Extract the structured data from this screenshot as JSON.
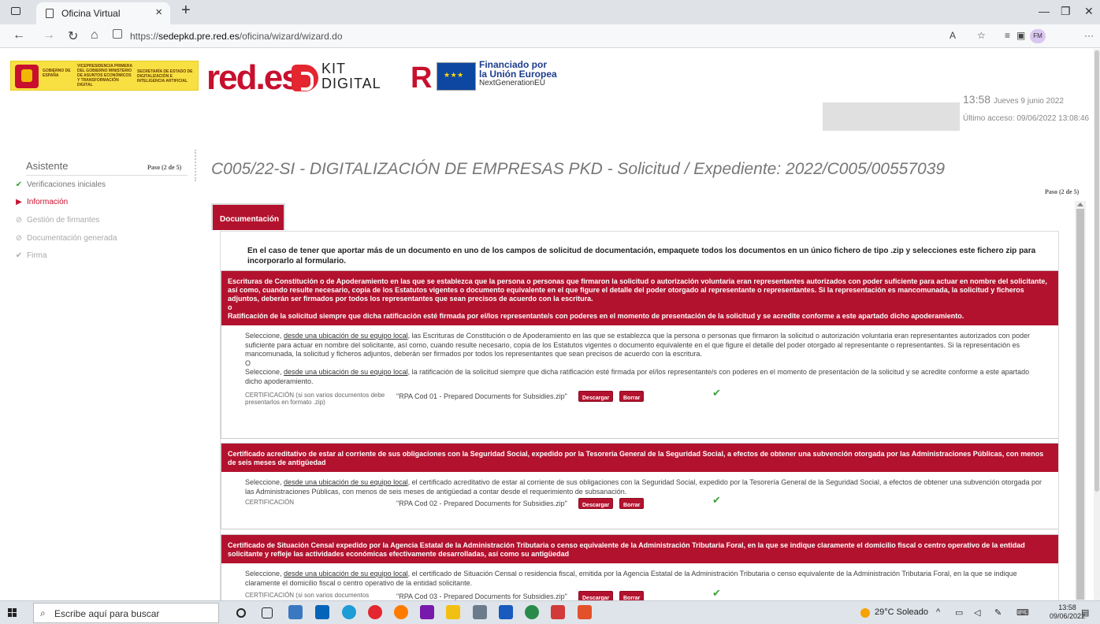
{
  "browser": {
    "tab_title": "Oficina Virtual",
    "tab_close": "×",
    "new_tab": "+",
    "url_prefix": "https://",
    "url_domain": "sedepkd.pre.red.es",
    "url_path": "/oficina/wizard/wizard.do",
    "profile_initials": "FM"
  },
  "header": {
    "gov_line1": "GOBIERNO DE ESPAÑA",
    "gov_line2": "VICEPRESIDENCIA PRIMERA DEL GOBIERNO MINISTERIO DE ASUNTOS ECONÓMICOS Y TRANSFORMACIÓN DIGITAL",
    "gov_line3": "SECRETARÍA DE ESTADO DE DIGITALIZACIÓN E INTELIGENCIA ARTIFICIAL",
    "redes": "red.es",
    "kit": "KIT",
    "digital": "DIGITAL",
    "eu_line1": "Financiado por",
    "eu_line2": "la Unión Europea",
    "eu_line3": "NextGenerationEU",
    "time": "13:58",
    "date": "Jueves 9 junio 2022",
    "last_access": "Último acceso: 09/06/2022 13:08:46"
  },
  "sidebar": {
    "title": "Asistente",
    "step": "Paso (2 de 5)",
    "items": [
      {
        "icon": "✔",
        "label": "Verificaciones iniciales"
      },
      {
        "icon": "▶",
        "label": "Información"
      },
      {
        "icon": "⊘",
        "label": "Gestión de firmantes"
      },
      {
        "icon": "⊘",
        "label": "Documentación generada"
      },
      {
        "icon": "✔",
        "label": "Firma"
      }
    ]
  },
  "main": {
    "title": "C005/22-SI - DIGITALIZACIÓN DE EMPRESAS PKD - Solicitud / Expediente: 2022/C005/00557039",
    "step": "Paso (2 de 5)",
    "tab_label": "Documentación",
    "intro": "En el caso de tener que aportar más de un documento en uno de los campos de solicitud de documentación, empaquete todos los documentos en un único fichero de tipo .zip y selecciones este fichero zip para incorporarlo al formulario.",
    "sections": [
      {
        "head1": "Escrituras de Constitución o de Apoderamiento en las que se establezca que la persona o personas que firmaron la solicitud o autorización voluntaria eran representantes autorizados con poder suficiente para actuar en nombre del solicitante, así como, cuando resulte necesario, copia de los Estatutos vigentes o documento equivalente en el que figure el detalle del poder otorgado al representante o representantes. Si la representación es mancomunada, la solicitud y ficheros adjuntos, deberán ser firmados por todos los representantes que sean precisos de acuerdo con la escritura.",
        "head_or": "o",
        "head2": "Ratificación de la solicitud siempre que dicha ratificación esté firmada por el/los representante/s con poderes en el momento de presentación de la solicitud y se acredite conforme a este apartado dicho apoderamiento.",
        "body_pre1": "Seleccione, ",
        "body_link1": "desde una ubicación de su equipo local",
        "body_post1": ", las Escrituras de Constitución o de Apoderamiento en las que se establezca que la persona o personas que firmaron la solicitud o autorización voluntaria eran representantes autorizados con poder suficiente para actuar en nombre del solicitante, así como, cuando resulte necesario, copia de los Estatutos vigentes o documento equivalente en el que figure el detalle del poder otorgado al representante o representantes. Si la representación es mancomunada, la solicitud y ficheros adjuntos, deberán ser firmados por todos los representantes que sean precisos de acuerdo con la escritura.",
        "body_or": "O",
        "body_pre2": "Seleccione, ",
        "body_link2": "desde una ubicación de su equipo local",
        "body_post2": ", la ratificación de la solicitud siempre que dicha ratificación esté firmada por el/los representante/s con poderes en el momento de presentación de la solicitud y se acredite conforme a este apartado dicho apoderamiento.",
        "cert_label": "CERTIFICACIÓN (si son varios documentos debe presentarlos en formato .zip)",
        "file": "\"RPA Cod 01 - Prepared Documents for Subsidies.zip\""
      },
      {
        "head1": "Certificado acreditativo de estar al corriente de sus obligaciones con la Seguridad Social, expedido por la Tesorería General de la Seguridad Social, a efectos de obtener una subvención otorgada por las Administraciones Públicas, con menos de seis meses de antigüedad",
        "body_pre1": "Seleccione, ",
        "body_link1": "desde una ubicación de su equipo local",
        "body_post1": ", el certificado acreditativo de estar al corriente de sus obligaciones con la Seguridad Social, expedido por la Tesorería General de la Seguridad Social, a efectos de obtener una subvención otorgada por las Administraciones Públicas, con menos de seis meses de antigüedad a contar desde el requerimiento de subsanación.",
        "cert_label": "CERTIFICACIÓN",
        "file": "\"RPA Cod 02 - Prepared Documents for Subsidies.zip\""
      },
      {
        "head1": "Certificado de Situación Censal expedido por la Agencia Estatal de la Administración Tributaria o censo equivalente de la Administración Tributaria Foral, en la que se indique claramente el domicilio fiscal o centro operativo de la entidad solicitante y refleje las actividades económicas efectivamente desarrolladas, así como su antigüedad",
        "body_pre1": "Seleccione, ",
        "body_link1": "desde una ubicación de su equipo local",
        "body_post1": ", el certificado de Situación Censal o residencia fiscal, emitida por la Agencia Estatal de la Administración Tributaria o censo equivalente de la Administración Tributaria Foral, en la que se indique claramente el domicilio fiscal o centro operativo de la entidad solicitante.",
        "cert_label": "CERTIFICACIÓN (si son varios documentos",
        "file": "\"RPA Cod 03 - Prepared Documents for Subsidies.zip\""
      }
    ],
    "btn_download": "Descargar",
    "btn_delete": "Borrar"
  },
  "taskbar": {
    "search_placeholder": "Escribe aquí para buscar",
    "weather": "29°C Soleado",
    "time": "13:58",
    "date": "09/06/2022"
  },
  "colors": {
    "brand_red": "#b3122e",
    "check_green": "#3aa33a"
  }
}
